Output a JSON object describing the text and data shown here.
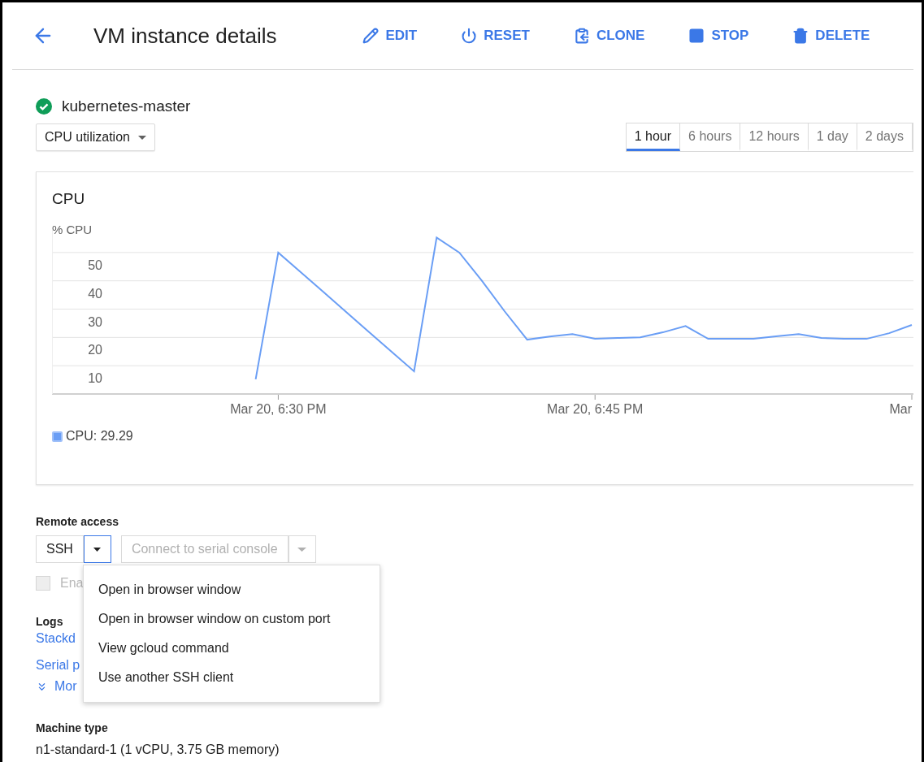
{
  "header": {
    "title": "VM instance details",
    "actions": [
      {
        "kind": "edit",
        "label": "EDIT"
      },
      {
        "kind": "reset",
        "label": "RESET"
      },
      {
        "kind": "clone",
        "label": "CLONE"
      },
      {
        "kind": "stop",
        "label": "STOP"
      },
      {
        "kind": "delete",
        "label": "DELETE"
      }
    ]
  },
  "instance": {
    "name": "kubernetes-master"
  },
  "metric_select": {
    "value": "CPU utilization"
  },
  "time_tabs": [
    {
      "label": "1 hour",
      "selected": true
    },
    {
      "label": "6 hours",
      "selected": false
    },
    {
      "label": "12 hours",
      "selected": false
    },
    {
      "label": "1 day",
      "selected": false
    },
    {
      "label": "2 days",
      "selected": false
    }
  ],
  "chart": {
    "title": "CPU",
    "legend": "CPU: 29.29",
    "chart_data": {
      "type": "line",
      "ylabel": "% CPU",
      "grid": true,
      "ylim": [
        0,
        58
      ],
      "yticks": [
        10,
        20,
        30,
        40,
        50
      ],
      "categories": [
        null,
        null,
        null,
        null,
        null,
        null,
        null,
        null,
        null,
        null,
        "Mar 20, 6:30 PM",
        null,
        null,
        null,
        null,
        null,
        null,
        null,
        null,
        null,
        null,
        null,
        null,
        null,
        "Mar 20, 6:45 PM",
        null,
        null,
        null,
        null,
        null,
        null,
        null,
        null,
        null,
        null,
        null,
        null,
        null,
        "Mar"
      ],
      "series": [
        {
          "color": "#6a9ef5",
          "values": [
            null,
            null,
            null,
            null,
            null,
            null,
            null,
            null,
            null,
            5.2,
            50,
            43,
            36,
            29,
            22,
            15,
            8,
            55.3,
            50,
            40,
            29.3,
            19.2,
            20.3,
            21.2,
            19.5,
            19.8,
            20,
            21.8,
            24,
            19.5,
            19.5,
            19.5,
            20.4,
            21.2,
            19.8,
            19.5,
            19.5,
            21.5,
            24.4
          ]
        }
      ]
    }
  },
  "remote_access": {
    "label": "Remote access",
    "ssh_button": "SSH",
    "ssh_menu_expanded": true,
    "serial_button": {
      "label": "Connect to serial console",
      "disabled": true
    },
    "checkbox": {
      "label": "Ena",
      "checked": false,
      "disabled": true
    },
    "menu": [
      "Open in browser window",
      "Open in browser window on custom port",
      "View gcloud command",
      "Use another SSH client"
    ]
  },
  "logs": {
    "label": "Logs",
    "links": [
      "Stackd",
      "Serial p"
    ],
    "more": "Mor"
  },
  "machine_type": {
    "label": "Machine type",
    "value": "n1-standard-1 (1 vCPU, 3.75 GB memory)"
  }
}
